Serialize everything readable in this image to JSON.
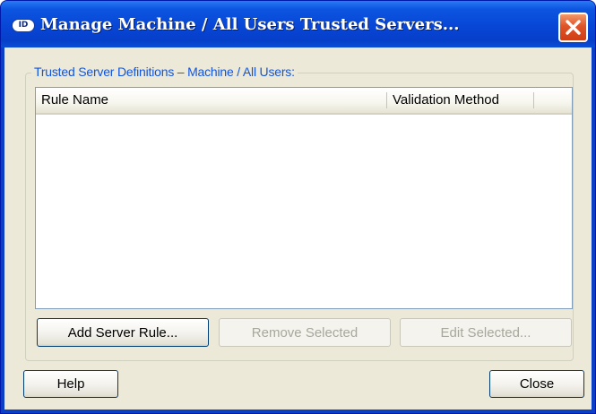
{
  "window": {
    "title": "Manage Machine / All Users Trusted Servers...",
    "app_icon_text": "ID"
  },
  "group": {
    "label": "Trusted Server Definitions – Machine / All Users:"
  },
  "list": {
    "columns": [
      "Rule Name",
      "Validation Method"
    ],
    "rows": []
  },
  "buttons": {
    "add_server_rule": "Add Server Rule...",
    "remove_selected": "Remove Selected",
    "edit_selected": "Edit Selected...",
    "help": "Help",
    "close": "Close"
  }
}
